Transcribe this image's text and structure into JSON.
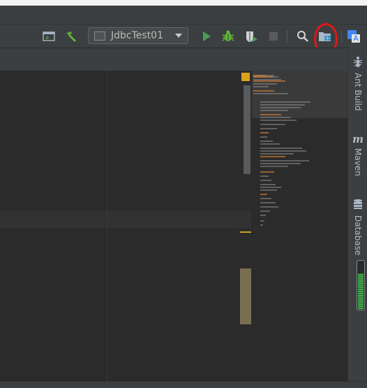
{
  "toolbar": {
    "run_configuration": "JdbcTest01",
    "icons": [
      "terminal-icon",
      "build-hammer-icon",
      "run-icon",
      "debug-icon",
      "coverage-icon",
      "stop-icon",
      "search-icon",
      "project-structure-icon",
      "translate-icon"
    ],
    "colors": {
      "run": "#499c54",
      "debug": "#5fb832",
      "stop": "#5a5a5a",
      "annotation": "#e01818"
    }
  },
  "sidebar": {
    "items": [
      {
        "label": "Ant Build",
        "icon": "ant-icon"
      },
      {
        "label": "Maven",
        "icon": "maven-icon"
      },
      {
        "label": "Database",
        "icon": "database-icon"
      }
    ]
  },
  "memory_indicator": {
    "level": 0.75
  }
}
